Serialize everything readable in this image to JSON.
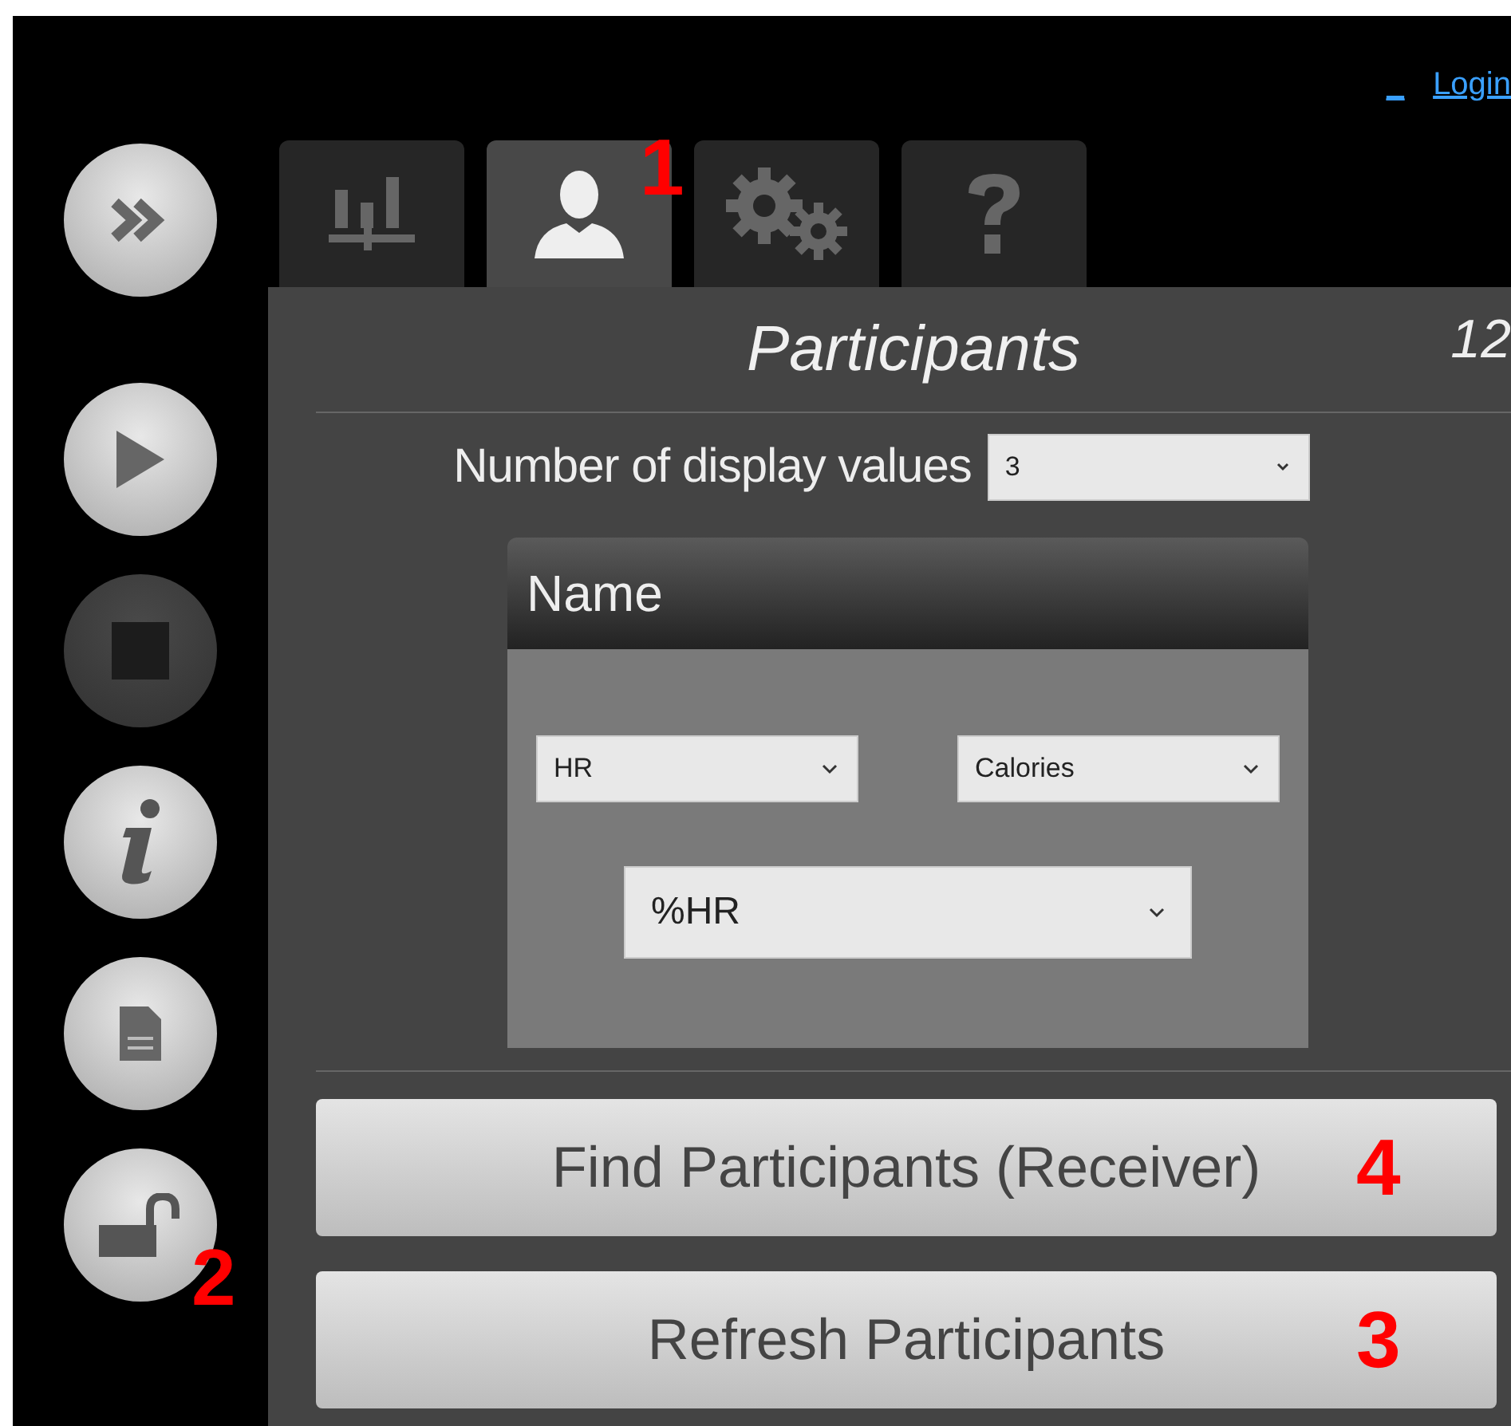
{
  "header_links": [
    {
      "label": "_"
    },
    {
      "label": "Login"
    }
  ],
  "sidebar": [
    {
      "kind": "forward",
      "disabled": false
    },
    {
      "kind": "play",
      "disabled": false
    },
    {
      "kind": "stop",
      "disabled": true
    },
    {
      "kind": "info",
      "disabled": false
    },
    {
      "kind": "document",
      "disabled": false
    },
    {
      "kind": "unlock",
      "disabled": false,
      "annotation": "2"
    }
  ],
  "tabs": [
    {
      "kind": "chart",
      "selected": false
    },
    {
      "kind": "person",
      "selected": true,
      "annotation": "1"
    },
    {
      "kind": "gears",
      "selected": false
    },
    {
      "kind": "help",
      "selected": false
    }
  ],
  "panel": {
    "title": "Participants",
    "count": "12",
    "display_values": {
      "label": "Number of display values",
      "value": "3"
    },
    "card": {
      "header": "Name",
      "selects": [
        {
          "value": "HR",
          "kind": "small"
        },
        {
          "value": "Calories",
          "kind": "small"
        },
        {
          "value": "%HR",
          "kind": "large"
        }
      ]
    },
    "buttons": [
      {
        "label": "Find Participants (Receiver)",
        "annotation": "4"
      },
      {
        "label": "Refresh Participants",
        "annotation": "3"
      }
    ]
  }
}
